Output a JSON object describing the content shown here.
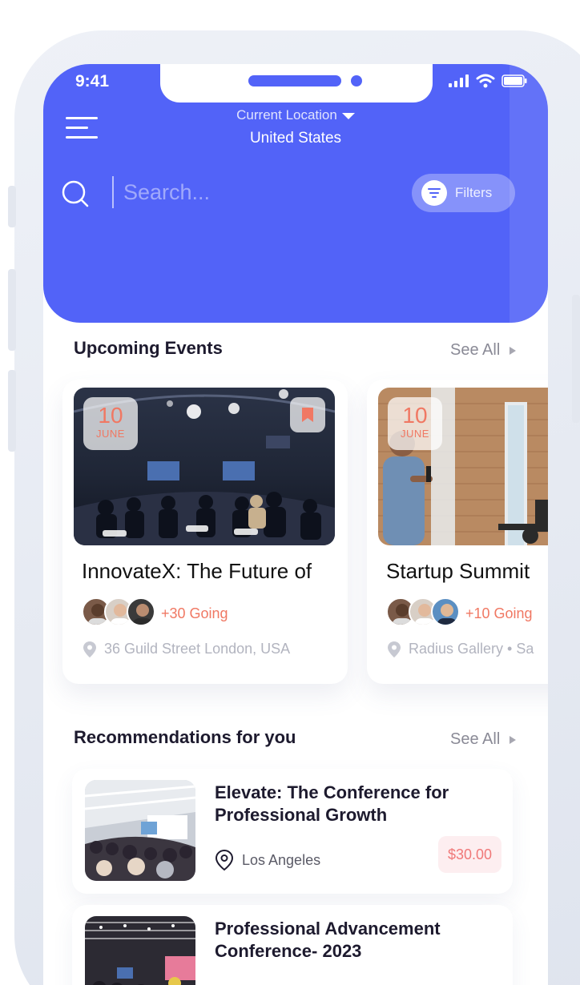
{
  "status": {
    "time": "9:41"
  },
  "header": {
    "location_label": "Current Location",
    "location_value": "United States",
    "search_placeholder": "Search...",
    "filters_label": "Filters",
    "accent_color": "#5263f8"
  },
  "upcoming": {
    "title": "Upcoming Events",
    "see_all": "See All",
    "events": [
      {
        "day": "10",
        "month": "JUNE",
        "title": "InnovateX: The Future of",
        "going": "+30 Going",
        "address": "36 Guild Street London, USA",
        "bookmarked": true
      },
      {
        "day": "10",
        "month": "JUNE",
        "title": "Startup Summit",
        "going": "+10 Going",
        "address": "Radius Gallery • Sa",
        "bookmarked": false
      }
    ]
  },
  "recommendations": {
    "title": "Recommendations for you",
    "see_all": "See All",
    "items": [
      {
        "title": "Elevate: The Conference for Professional Growth",
        "location": "Los Angeles",
        "price": "$30.00"
      },
      {
        "title": "Professional Advancement Conference- 2023",
        "location": "",
        "price": ""
      }
    ]
  }
}
